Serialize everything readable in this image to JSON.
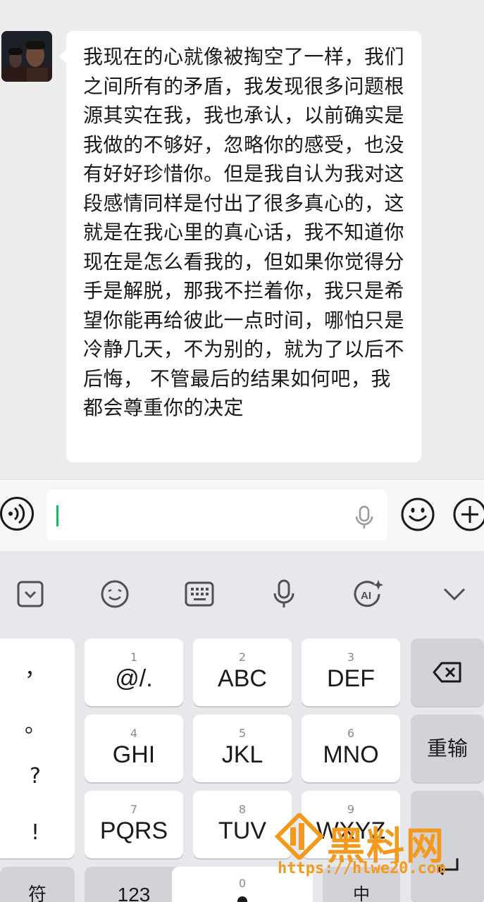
{
  "chat": {
    "message": "我现在的心就像被掏空了一样，我们之间所有的矛盾，我发现很多问题根源其实在我，我也承认，以前确实是我做的不够好，忽略你的感受，也没有好好珍惜你。但是我自认为我对这段感情同样是付出了很多真心的，这就是在我心里的真心话，我不知道你现在是怎么看我的，但如果你觉得分手是解脱，那我不拦着你，我只是希望你能再给彼此一点时间，哪怕只是冷静几天，不为别的，就为了以后不后悔， 不管最后的结果如何吧，我都会尊重你的决定"
  },
  "input_bar": {
    "value": "",
    "icons": [
      "voice-icon",
      "mic-icon",
      "emoji-icon",
      "plus-icon"
    ]
  },
  "keyboard": {
    "toolbar": [
      "collapse-icon",
      "emoticon-icon",
      "keyboard-icon",
      "mic-icon",
      "ai-icon",
      "chevron-down-icon"
    ],
    "symbols": [
      "，",
      "。",
      "?",
      "!"
    ],
    "keys": [
      {
        "num": "1",
        "label": "@/."
      },
      {
        "num": "2",
        "label": "ABC"
      },
      {
        "num": "3",
        "label": "DEF"
      },
      {
        "num": "4",
        "label": "GHI"
      },
      {
        "num": "5",
        "label": "JKL"
      },
      {
        "num": "6",
        "label": "MNO"
      },
      {
        "num": "7",
        "label": "PQRS"
      },
      {
        "num": "8",
        "label": "TUV"
      },
      {
        "num": "9",
        "label": "WXYZ"
      },
      {
        "num": "0",
        "label": ""
      }
    ],
    "reinput_label": "重输",
    "bottom": {
      "sym": "符",
      "num": "123",
      "lang": "中"
    }
  },
  "watermark": {
    "brand": "黑料网",
    "url": "https://hlwe20.com"
  },
  "colors": {
    "accent": "#07c160",
    "watermark": "#f39a1e"
  }
}
